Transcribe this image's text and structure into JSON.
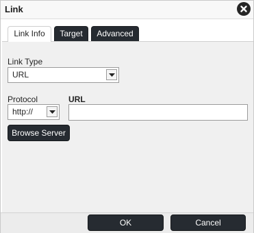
{
  "dialog": {
    "title": "Link"
  },
  "tabs": [
    {
      "label": "Link Info",
      "active": true
    },
    {
      "label": "Target",
      "active": false
    },
    {
      "label": "Advanced",
      "active": false
    }
  ],
  "form": {
    "link_type_label": "Link Type",
    "link_type_value": "URL",
    "protocol_label": "Protocol",
    "protocol_value": "http://",
    "url_label": "URL",
    "url_value": "",
    "browse_server_label": "Browse Server"
  },
  "footer": {
    "ok_label": "OK",
    "cancel_label": "Cancel"
  },
  "colors": {
    "dark_button": "#262b31",
    "panel_bg": "#f0f0f0"
  }
}
